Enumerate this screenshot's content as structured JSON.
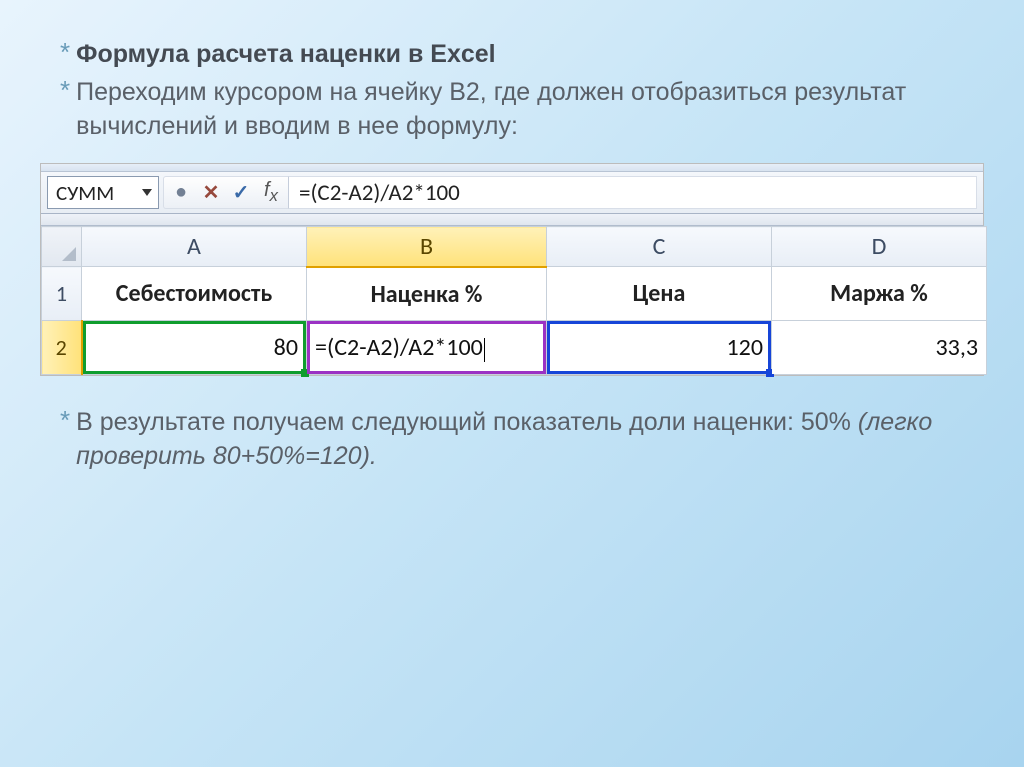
{
  "slide": {
    "title": "Формула расчета наценки в Excel",
    "intro": "Переходим курсором на ячейку B2, где должен отобразиться результат вычислений и вводим в нее формулу:",
    "result_prefix": "В результате получаем следующий показатель доли наценки: ",
    "result_value": "50%",
    "result_italic": " (легко проверить 80+50%=120)."
  },
  "excel": {
    "name_box": "СУММ",
    "formula_bar": "=(C2-A2)/A2*100",
    "columns": [
      "A",
      "B",
      "C",
      "D"
    ],
    "row_numbers": [
      "1",
      "2"
    ],
    "headers": {
      "A": "Себестоимость",
      "B": "Наценка %",
      "C": "Цена",
      "D": "Маржа %"
    },
    "row2": {
      "A": "80",
      "B": "=(C2-A2)/A2*100",
      "C": "120",
      "D": "33,3"
    },
    "active_cell": "B2"
  }
}
